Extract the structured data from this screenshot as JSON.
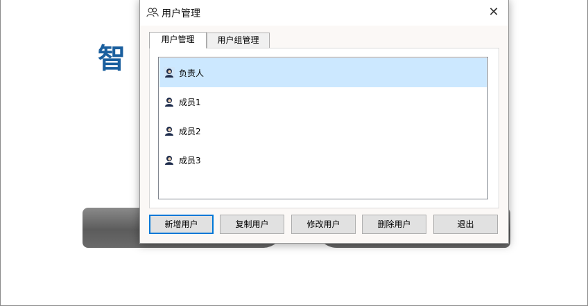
{
  "background": {
    "title_partial": "智"
  },
  "dialog": {
    "title": "用户管理",
    "close_label": "✕",
    "tabs": [
      {
        "label": "用户管理",
        "active": true
      },
      {
        "label": "用户组管理",
        "active": false
      }
    ],
    "users": [
      {
        "label": "负责人",
        "selected": true
      },
      {
        "label": "成员1",
        "selected": false
      },
      {
        "label": "成员2",
        "selected": false
      },
      {
        "label": "成员3",
        "selected": false
      }
    ],
    "buttons": {
      "add": "新增用户",
      "copy": "复制用户",
      "edit": "修改用户",
      "delete": "删除用户",
      "exit": "退出"
    }
  },
  "colors": {
    "selection": "#cce8ff",
    "default_button_border": "#0078d7",
    "background_title": "#1a5f9e"
  }
}
